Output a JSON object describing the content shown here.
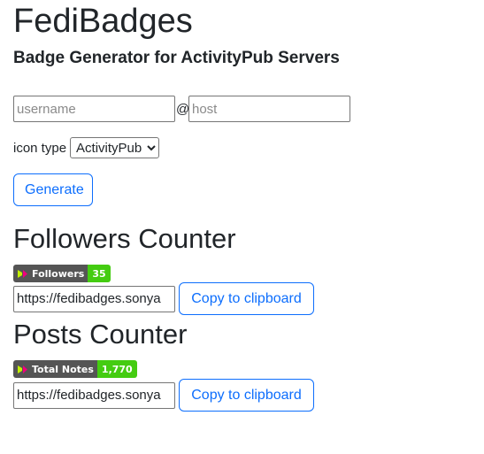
{
  "app": {
    "title": "FediBadges",
    "subtitle": "Badge Generator for ActivityPub Servers"
  },
  "form": {
    "username_placeholder": "username",
    "at_sign": "@",
    "host_placeholder": "host",
    "icon_type_label": "icon type",
    "icon_type_selected": "ActivityPub",
    "generate_label": "Generate"
  },
  "followers": {
    "heading": "Followers Counter",
    "badge_label": "Followers",
    "badge_value": "35",
    "url_value": "https://fedibadges.sonya",
    "copy_label": "Copy to clipboard"
  },
  "posts": {
    "heading": "Posts Counter",
    "badge_label": "Total Notes",
    "badge_value": "1,770",
    "url_value": "https://fedibadges.sonya",
    "copy_label": "Copy to clipboard"
  },
  "colors": {
    "accent": "#0d6efd",
    "badge_left": "#555555",
    "badge_right": "#44cc11",
    "activitypub_icon": "#f1007e"
  },
  "icons": {
    "badge_icon": "activitypub-icon"
  }
}
